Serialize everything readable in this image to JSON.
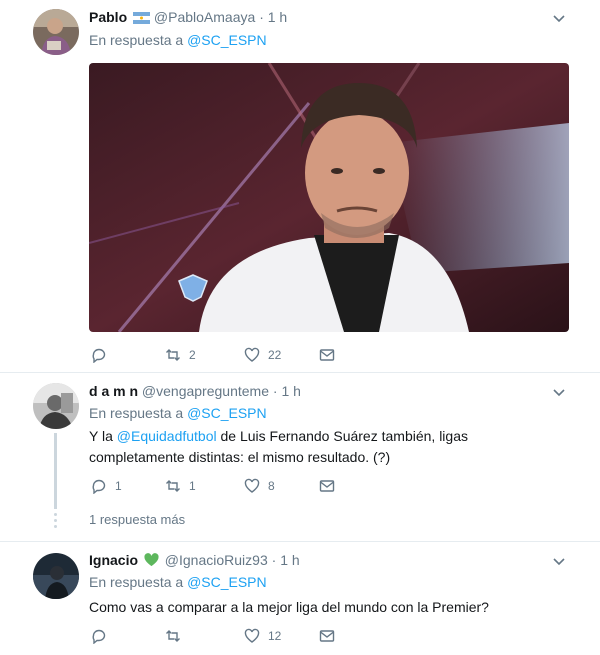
{
  "tweets": [
    {
      "name": "Pablo",
      "handle": "@PabloAmaaya",
      "separator": "·",
      "time": "1 h",
      "reply_prefix": "En respuesta a",
      "reply_to": "@SC_ESPN",
      "actions": {
        "reply": "",
        "retweet": "2",
        "like": "22",
        "message": ""
      }
    },
    {
      "name": "d a m n",
      "handle": "@vengapregunteme",
      "separator": "·",
      "time": "1 h",
      "reply_prefix": "En respuesta a",
      "reply_to": "@SC_ESPN",
      "text_before": "Y la ",
      "text_mention": "@Equidadfutbol",
      "text_after": " de Luis Fernando Suárez también, ligas completamente distintas: el mismo resultado. (?)",
      "actions": {
        "reply": "1",
        "retweet": "1",
        "like": "8",
        "message": ""
      },
      "more_replies": "1 respuesta más"
    },
    {
      "name": "Ignacio",
      "handle": "@IgnacioRuiz93",
      "separator": "·",
      "time": "1 h",
      "reply_prefix": "En respuesta a",
      "reply_to": "@SC_ESPN",
      "text": "Como vas a comparar a la mejor liga del mundo con la Premier?",
      "actions": {
        "reply": "",
        "retweet": "",
        "like": "12",
        "message": ""
      }
    }
  ],
  "colors": {
    "link": "#1da1f2",
    "secondary_text": "#657786",
    "primary_text": "#14171a",
    "divider": "#e6ecf0",
    "heart_badge": "#5db75d"
  },
  "icons": [
    "argentina-flag-icon",
    "green-heart-icon",
    "chevron-down-icon",
    "reply-icon",
    "retweet-icon",
    "like-icon",
    "direct-message-icon"
  ]
}
